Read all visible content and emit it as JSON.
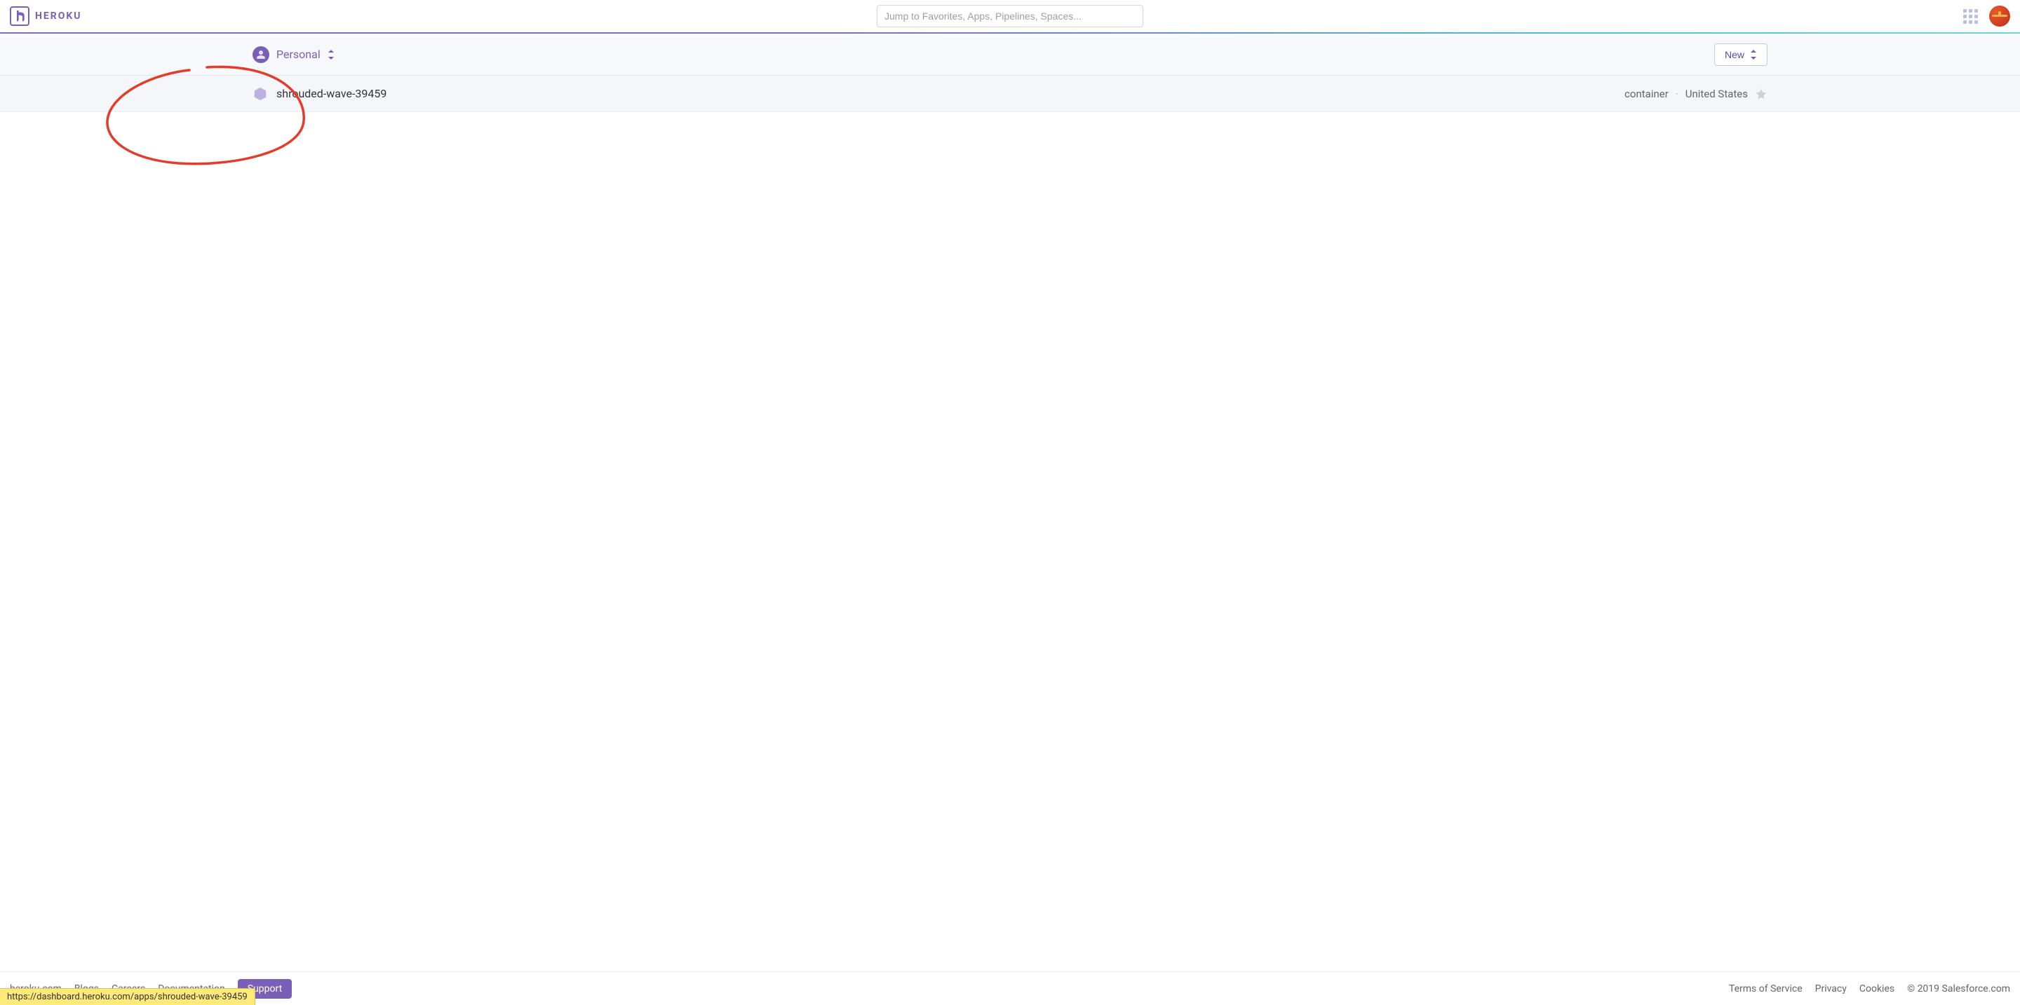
{
  "header": {
    "brand": "HEROKU",
    "search_placeholder": "Jump to Favorites, Apps, Pipelines, Spaces..."
  },
  "subheader": {
    "team_label": "Personal",
    "new_button_label": "New"
  },
  "apps": [
    {
      "name": "shrouded-wave-39459",
      "stack": "container",
      "region": "United States"
    }
  ],
  "footer": {
    "links": [
      "heroku.com",
      "Blogs",
      "Careers",
      "Documentation"
    ],
    "support_label": "Support",
    "legal": [
      "Terms of Service",
      "Privacy",
      "Cookies"
    ],
    "copyright": "© 2019 Salesforce.com"
  },
  "status_bar": {
    "url": "https://dashboard.heroku.com/apps/shrouded-wave-39459"
  }
}
